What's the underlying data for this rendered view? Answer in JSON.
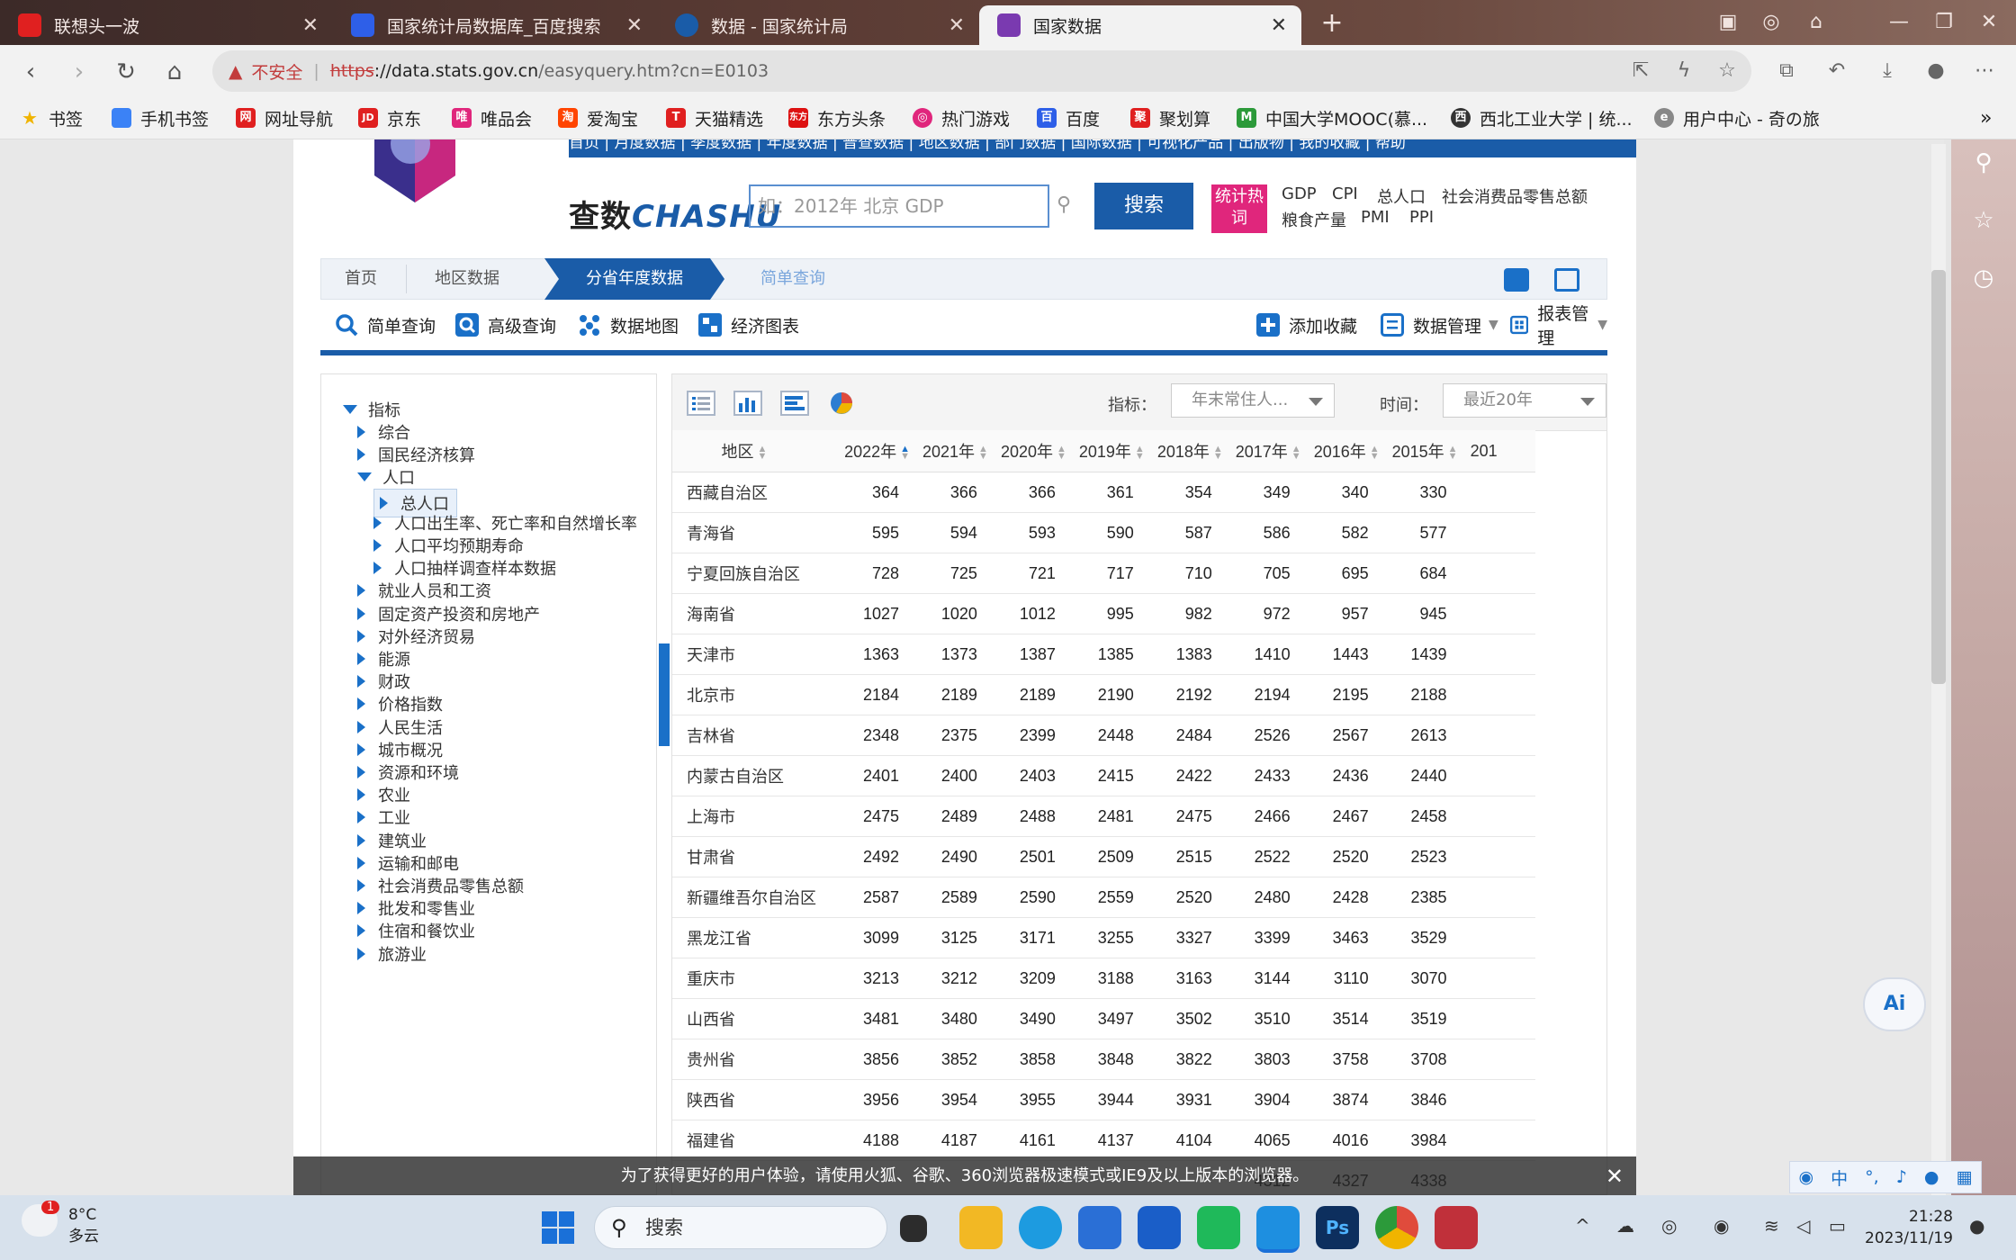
{
  "browser": {
    "tabs": [
      {
        "title": "联想头一波",
        "color": "#e02020"
      },
      {
        "title": "国家统计局数据库_百度搜索",
        "color": "#2e5fe8"
      },
      {
        "title": "数据 - 国家统计局",
        "color": "#1a5ca8"
      },
      {
        "title": "国家数据",
        "color": "#7a3ab0"
      }
    ],
    "new_tab_symbol": "+",
    "address": {
      "security_label": "不安全",
      "scheme": "https",
      "host": "://data.stats.gov.cn",
      "path": "/easyquery.htm?cn=E0103"
    },
    "bookmarks": [
      {
        "label": "书签",
        "color": "#f0b400",
        "glyph": "★"
      },
      {
        "label": "手机书签",
        "color": "#3b82f6",
        "glyph": "▯"
      },
      {
        "label": "网址导航",
        "color": "#e02020",
        "glyph": "网"
      },
      {
        "label": "京东",
        "color": "#e02020",
        "glyph": "JD"
      },
      {
        "label": "唯品会",
        "color": "#e0267c",
        "glyph": "唯"
      },
      {
        "label": "爱淘宝",
        "color": "#ff4400",
        "glyph": "淘"
      },
      {
        "label": "天猫精选",
        "color": "#e02020",
        "glyph": "T"
      },
      {
        "label": "东方头条",
        "color": "#d11",
        "glyph": "东"
      },
      {
        "label": "热门游戏",
        "color": "#e0267c",
        "glyph": "◎"
      },
      {
        "label": "百度",
        "color": "#2e5fe8",
        "glyph": "百"
      },
      {
        "label": "聚划算",
        "color": "#e02020",
        "glyph": "聚"
      },
      {
        "label": "中国大学MOOC(慕...",
        "color": "#2c9a3a",
        "glyph": "M"
      },
      {
        "label": "西北工业大学 | 统...",
        "color": "#333",
        "glyph": "西"
      },
      {
        "label": "用户中心 - 奇の旅",
        "color": "#888",
        "glyph": "e"
      }
    ],
    "bookmarks_more": "»"
  },
  "site": {
    "top_nav": "首页 | 月度数据 | 季度数据 | 年度数据 | 普查数据 | 地区数据 | 部门数据 | 国际数据 | 可视化产品 | 出版物 | 我的收藏 | 帮助",
    "chashu_logo": {
      "cn": "查数",
      "en": "CHASHU"
    },
    "search": {
      "placeholder": "如：2012年 北京 GDP",
      "button": "搜索"
    },
    "hot_badge": "统计热词",
    "hot_terms_row1": [
      "GDP",
      "CPI",
      "总人口",
      "社会消费品零售总额"
    ],
    "hot_terms_row2": [
      "粮食产量",
      "PMI",
      "PPI"
    ],
    "breadcrumb": {
      "home": "首页",
      "region": "地区数据",
      "active": "分省年度数据",
      "current": "简单查询"
    },
    "toolbar": {
      "simple_query": "简单查询",
      "advanced_query": "高级查询",
      "data_map": "数据地图",
      "econ_chart": "经济图表",
      "add_favorite": "添加收藏",
      "data_manage": "数据管理",
      "report_manage": "报表管理"
    },
    "tree": {
      "root": "指标",
      "items": [
        {
          "label": "综合",
          "level": 1,
          "state": "collapsed"
        },
        {
          "label": "国民经济核算",
          "level": 1,
          "state": "collapsed"
        },
        {
          "label": "人口",
          "level": 1,
          "state": "expanded"
        },
        {
          "label": "总人口",
          "level": 2,
          "state": "selected"
        },
        {
          "label": "人口出生率、死亡率和自然增长率",
          "level": 2,
          "state": "collapsed"
        },
        {
          "label": "人口平均预期寿命",
          "level": 2,
          "state": "collapsed"
        },
        {
          "label": "人口抽样调查样本数据",
          "level": 2,
          "state": "collapsed"
        },
        {
          "label": "就业人员和工资",
          "level": 1,
          "state": "collapsed"
        },
        {
          "label": "固定资产投资和房地产",
          "level": 1,
          "state": "collapsed"
        },
        {
          "label": "对外经济贸易",
          "level": 1,
          "state": "collapsed"
        },
        {
          "label": "能源",
          "level": 1,
          "state": "collapsed"
        },
        {
          "label": "财政",
          "level": 1,
          "state": "collapsed"
        },
        {
          "label": "价格指数",
          "level": 1,
          "state": "collapsed"
        },
        {
          "label": "人民生活",
          "level": 1,
          "state": "collapsed"
        },
        {
          "label": "城市概况",
          "level": 1,
          "state": "collapsed"
        },
        {
          "label": "资源和环境",
          "level": 1,
          "state": "collapsed"
        },
        {
          "label": "农业",
          "level": 1,
          "state": "collapsed"
        },
        {
          "label": "工业",
          "level": 1,
          "state": "collapsed"
        },
        {
          "label": "建筑业",
          "level": 1,
          "state": "collapsed"
        },
        {
          "label": "运输和邮电",
          "level": 1,
          "state": "collapsed"
        },
        {
          "label": "社会消费品零售总额",
          "level": 1,
          "state": "collapsed"
        },
        {
          "label": "批发和零售业",
          "level": 1,
          "state": "collapsed"
        },
        {
          "label": "住宿和餐饮业",
          "level": 1,
          "state": "collapsed"
        },
        {
          "label": "旅游业",
          "level": 1,
          "state": "collapsed"
        }
      ]
    },
    "filters": {
      "indicator_label": "指标：",
      "indicator_value": "年末常住人...",
      "time_label": "时间：",
      "time_value": "最近20年"
    },
    "table": {
      "region_header": "地区",
      "years": [
        "2022年",
        "2021年",
        "2020年",
        "2019年",
        "2018年",
        "2017年",
        "2016年",
        "2015年",
        "201"
      ],
      "rows": [
        {
          "region": "西藏自治区",
          "values": [
            "364",
            "366",
            "366",
            "361",
            "354",
            "349",
            "340",
            "330"
          ]
        },
        {
          "region": "青海省",
          "values": [
            "595",
            "594",
            "593",
            "590",
            "587",
            "586",
            "582",
            "577"
          ]
        },
        {
          "region": "宁夏回族自治区",
          "values": [
            "728",
            "725",
            "721",
            "717",
            "710",
            "705",
            "695",
            "684"
          ]
        },
        {
          "region": "海南省",
          "values": [
            "1027",
            "1020",
            "1012",
            "995",
            "982",
            "972",
            "957",
            "945"
          ]
        },
        {
          "region": "天津市",
          "values": [
            "1363",
            "1373",
            "1387",
            "1385",
            "1383",
            "1410",
            "1443",
            "1439"
          ]
        },
        {
          "region": "北京市",
          "values": [
            "2184",
            "2189",
            "2189",
            "2190",
            "2192",
            "2194",
            "2195",
            "2188"
          ]
        },
        {
          "region": "吉林省",
          "values": [
            "2348",
            "2375",
            "2399",
            "2448",
            "2484",
            "2526",
            "2567",
            "2613"
          ]
        },
        {
          "region": "内蒙古自治区",
          "values": [
            "2401",
            "2400",
            "2403",
            "2415",
            "2422",
            "2433",
            "2436",
            "2440"
          ]
        },
        {
          "region": "上海市",
          "values": [
            "2475",
            "2489",
            "2488",
            "2481",
            "2475",
            "2466",
            "2467",
            "2458"
          ]
        },
        {
          "region": "甘肃省",
          "values": [
            "2492",
            "2490",
            "2501",
            "2509",
            "2515",
            "2522",
            "2520",
            "2523"
          ]
        },
        {
          "region": "新疆维吾尔自治区",
          "values": [
            "2587",
            "2589",
            "2590",
            "2559",
            "2520",
            "2480",
            "2428",
            "2385"
          ]
        },
        {
          "region": "黑龙江省",
          "values": [
            "3099",
            "3125",
            "3171",
            "3255",
            "3327",
            "3399",
            "3463",
            "3529"
          ]
        },
        {
          "region": "重庆市",
          "values": [
            "3213",
            "3212",
            "3209",
            "3188",
            "3163",
            "3144",
            "3110",
            "3070"
          ]
        },
        {
          "region": "山西省",
          "values": [
            "3481",
            "3480",
            "3490",
            "3497",
            "3502",
            "3510",
            "3514",
            "3519"
          ]
        },
        {
          "region": "贵州省",
          "values": [
            "3856",
            "3852",
            "3858",
            "3848",
            "3822",
            "3803",
            "3758",
            "3708"
          ]
        },
        {
          "region": "陕西省",
          "values": [
            "3956",
            "3954",
            "3955",
            "3944",
            "3931",
            "3904",
            "3874",
            "3846"
          ]
        },
        {
          "region": "福建省",
          "values": [
            "4188",
            "4187",
            "4161",
            "4137",
            "4104",
            "4065",
            "4016",
            "3984"
          ]
        },
        {
          "region": "",
          "values": [
            "",
            "",
            "",
            "",
            "",
            "4312",
            "4327",
            "4338"
          ]
        }
      ]
    },
    "notice": "为了获得更好的用户体验，请使用火狐、谷歌、360浏览器极速模式或IE9及以上版本的浏览器。"
  },
  "taskbar": {
    "weather": {
      "temp": "8°C",
      "desc": "多云",
      "badge": "1"
    },
    "search_label": "搜索",
    "time": "21:28",
    "date": "2023/11/19",
    "ime_lang": "中"
  },
  "ai_button": "Ai"
}
